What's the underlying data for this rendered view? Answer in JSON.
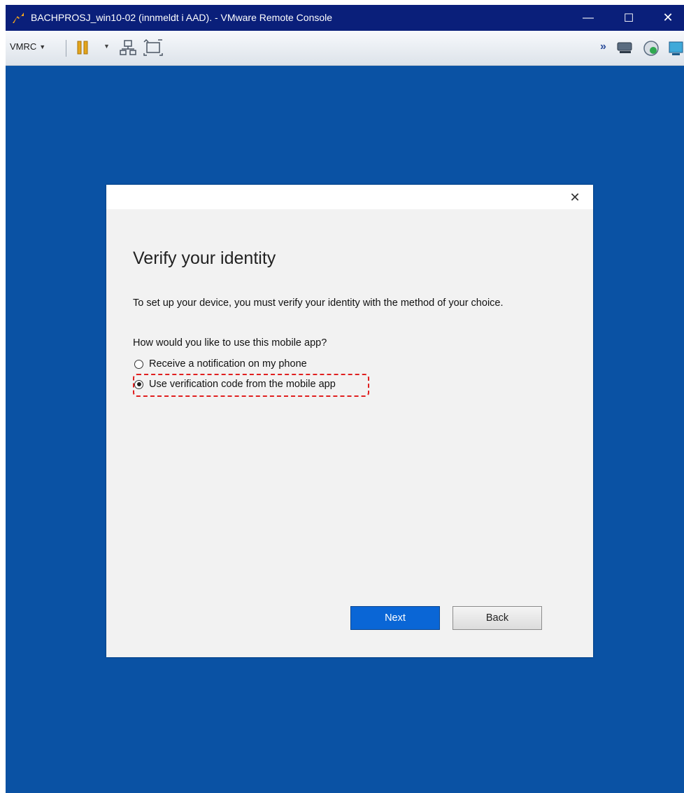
{
  "window": {
    "title": "BACHPROSJ_win10-02 (innmeldt i AAD). - VMware Remote Console",
    "controls": {
      "minimize": "—",
      "maximize": "☐",
      "close": "✕"
    }
  },
  "toolbar": {
    "vmrc_label": "VMRC",
    "icons": [
      "pause-icon",
      "network-icon",
      "fullscreen-icon",
      "device-icon",
      "connect-icon",
      "display-icon"
    ],
    "overflow_glyph": "»"
  },
  "dialog": {
    "close_glyph": "✕",
    "title": "Verify your identity",
    "description": "To set up your device, you must verify your identity with the method of your choice.",
    "question": "How would you like to use this mobile app?",
    "options": [
      {
        "label": "Receive a notification on my phone",
        "selected": false
      },
      {
        "label": "Use verification code from the mobile app",
        "selected": true
      }
    ],
    "next_label": "Next",
    "back_label": "Back"
  },
  "colors": {
    "desktop_background": "#0a52a4",
    "titlebar": "#0a1f7a",
    "primary_button": "#0a66d6",
    "highlight": "#e02020"
  }
}
